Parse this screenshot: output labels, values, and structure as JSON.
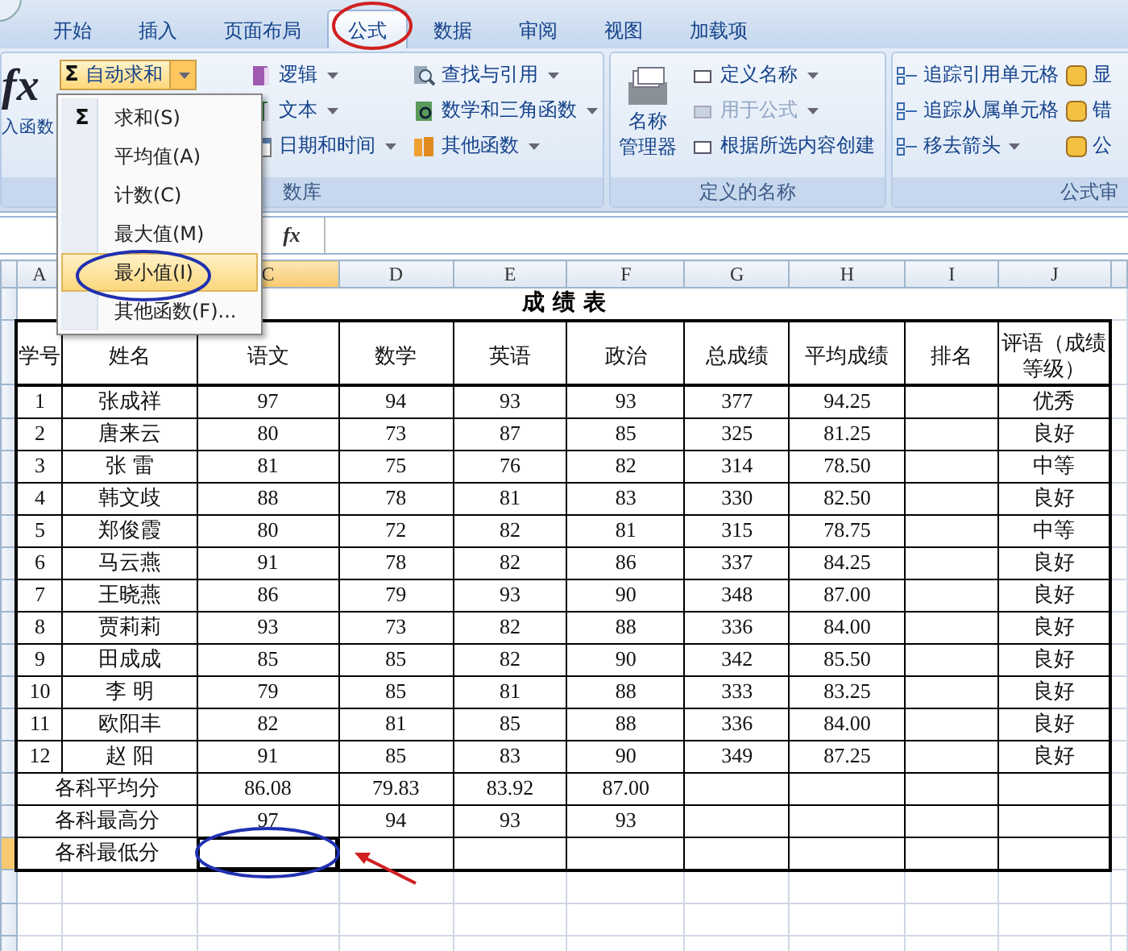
{
  "tabs": [
    {
      "label": "开始",
      "selected": false
    },
    {
      "label": "插入",
      "selected": false
    },
    {
      "label": "页面布局",
      "selected": false
    },
    {
      "label": "公式",
      "selected": true
    },
    {
      "label": "数据",
      "selected": false
    },
    {
      "label": "审阅",
      "selected": false
    },
    {
      "label": "视图",
      "selected": false
    },
    {
      "label": "加载项",
      "selected": false
    }
  ],
  "ribbon": {
    "function_library": {
      "label": "数库",
      "insert_function": {
        "icon": "fx",
        "label": "入函数"
      },
      "autosum": {
        "icon": "Σ",
        "label": "自动求和",
        "expanded": true
      },
      "items": [
        {
          "label": "逻辑",
          "kind": "logic",
          "dropdown": true
        },
        {
          "label": "文本",
          "kind": "text",
          "dropdown": true
        },
        {
          "label": "日期和时间",
          "kind": "date",
          "dropdown": true
        },
        {
          "label": "查找与引用",
          "kind": "lookup",
          "dropdown": true
        },
        {
          "label": "数学和三角函数",
          "kind": "math",
          "dropdown": true
        },
        {
          "label": "其他函数",
          "kind": "more",
          "dropdown": true
        }
      ]
    },
    "defined_names": {
      "label": "定义的名称",
      "name_manager": [
        "名称",
        "管理器"
      ],
      "items": [
        {
          "label": "定义名称",
          "dropdown": true,
          "disabled": false
        },
        {
          "label": "用于公式",
          "dropdown": true,
          "disabled": true
        },
        {
          "label": "根据所选内容创建",
          "dropdown": false,
          "disabled": false
        }
      ]
    },
    "auditing": {
      "label": "公式审",
      "items": [
        {
          "label": "追踪引用单元格",
          "dropdown": false
        },
        {
          "label": "追踪从属单元格",
          "dropdown": false
        },
        {
          "label": "移去箭头",
          "dropdown": true
        }
      ],
      "side_items": [
        {
          "label": "显"
        },
        {
          "label": "错"
        },
        {
          "label": "公"
        }
      ]
    }
  },
  "formula_bar": {
    "icon": "fx"
  },
  "menu": {
    "items": [
      {
        "label": "求和(S)",
        "icon": "Σ",
        "selected": false
      },
      {
        "label": "平均值(A)",
        "selected": false
      },
      {
        "label": "计数(C)",
        "selected": false
      },
      {
        "label": "最大值(M)",
        "selected": false
      },
      {
        "label": "最小值(I)",
        "selected": true
      },
      {
        "label": "其他函数(F)...",
        "selected": false
      }
    ]
  },
  "sheet": {
    "columns": [
      {
        "label": "A",
        "selected": false
      },
      {
        "label": "C",
        "selected": true
      },
      {
        "label": "D",
        "selected": false
      },
      {
        "label": "E",
        "selected": false
      },
      {
        "label": "F",
        "selected": false
      },
      {
        "label": "G",
        "selected": false
      },
      {
        "label": "H",
        "selected": false
      },
      {
        "label": "I",
        "selected": false
      },
      {
        "label": "J",
        "selected": false
      }
    ],
    "title": "成 绩 表",
    "header": [
      "学号",
      "姓名",
      "语文",
      "数学",
      "英语",
      "政治",
      "总成绩",
      "平均成绩",
      "排名",
      "评语（成绩等级）"
    ],
    "rows": [
      {
        "no": "1",
        "name": "张成祥",
        "scores": [
          "97",
          "94",
          "93",
          "93"
        ],
        "total": "377",
        "average": "94.25",
        "grade": "优秀"
      },
      {
        "no": "2",
        "name": "唐来云",
        "scores": [
          "80",
          "73",
          "87",
          "85"
        ],
        "total": "325",
        "average": "81.25",
        "grade": "良好"
      },
      {
        "no": "3",
        "name": "张  雷",
        "scores": [
          "81",
          "75",
          "76",
          "82"
        ],
        "total": "314",
        "average": "78.50",
        "grade": "中等"
      },
      {
        "no": "4",
        "name": "韩文歧",
        "scores": [
          "88",
          "78",
          "81",
          "83"
        ],
        "total": "330",
        "average": "82.50",
        "grade": "良好"
      },
      {
        "no": "5",
        "name": "郑俊霞",
        "scores": [
          "80",
          "72",
          "82",
          "81"
        ],
        "total": "315",
        "average": "78.75",
        "grade": "中等"
      },
      {
        "no": "6",
        "name": "马云燕",
        "scores": [
          "91",
          "78",
          "82",
          "86"
        ],
        "total": "337",
        "average": "84.25",
        "grade": "良好"
      },
      {
        "no": "7",
        "name": "王晓燕",
        "scores": [
          "86",
          "79",
          "93",
          "90"
        ],
        "total": "348",
        "average": "87.00",
        "grade": "良好"
      },
      {
        "no": "8",
        "name": "贾莉莉",
        "scores": [
          "93",
          "73",
          "82",
          "88"
        ],
        "total": "336",
        "average": "84.00",
        "grade": "良好"
      },
      {
        "no": "9",
        "name": "田成成",
        "scores": [
          "85",
          "85",
          "82",
          "90"
        ],
        "total": "342",
        "average": "85.50",
        "grade": "良好"
      },
      {
        "no": "10",
        "name": "李  明",
        "scores": [
          "79",
          "85",
          "81",
          "88"
        ],
        "total": "333",
        "average": "83.25",
        "grade": "良好"
      },
      {
        "no": "11",
        "name": "欧阳丰",
        "scores": [
          "82",
          "81",
          "85",
          "88"
        ],
        "total": "336",
        "average": "84.00",
        "grade": "良好"
      },
      {
        "no": "12",
        "name": "赵  阳",
        "scores": [
          "91",
          "85",
          "83",
          "90"
        ],
        "total": "349",
        "average": "87.25",
        "grade": "良好"
      }
    ],
    "summary": [
      {
        "label": "各科平均分",
        "values": [
          "86.08",
          "79.83",
          "83.92",
          "87.00"
        ],
        "selected": false
      },
      {
        "label": "各科最高分",
        "values": [
          "97",
          "94",
          "93",
          "93"
        ],
        "selected": false
      },
      {
        "label": "各科最低分",
        "selected": true
      }
    ]
  }
}
